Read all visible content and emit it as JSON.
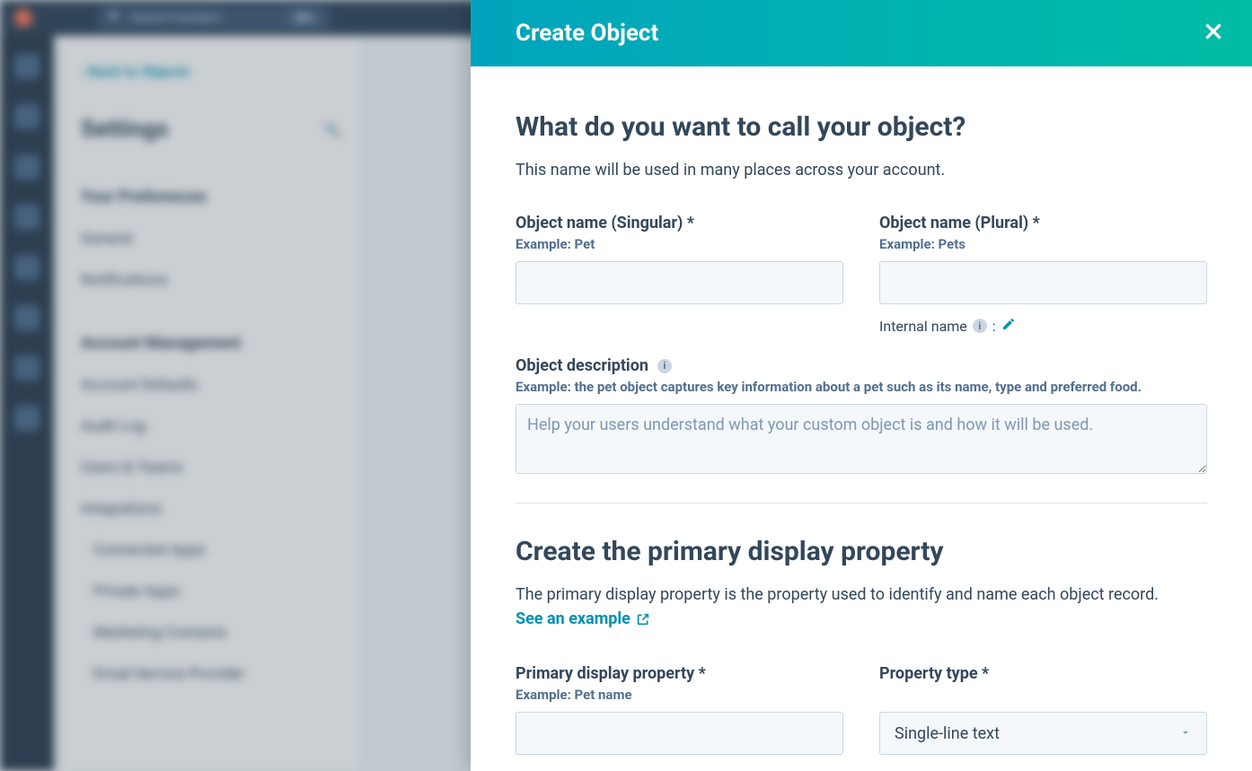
{
  "bg": {
    "search_placeholder": "Search HubSpot",
    "search_shortcut": "⌘K",
    "back_link": "‹ Back to Objects",
    "settings_title": "Settings",
    "section_prefs": "Your Preferences",
    "nav_general": "General",
    "nav_notifications": "Notifications",
    "section_account": "Account Management",
    "nav_account_defaults": "Account Defaults",
    "nav_audit_log": "Audit Log",
    "nav_users_teams": "Users & Teams",
    "nav_integrations": "Integrations",
    "nav_connected_apps": "Connected Apps",
    "nav_private_apps": "Private Apps",
    "nav_marketing_contacts": "Marketing Contacts",
    "nav_email_provider": "Email Service Provider"
  },
  "panel": {
    "title": "Create Object",
    "section1_heading": "What do you want to call your object?",
    "section1_desc": "This name will be used in many places across your account.",
    "singular_label": "Object name (Singular) *",
    "singular_example": "Example: Pet",
    "plural_label": "Object name (Plural) *",
    "plural_example": "Example: Pets",
    "internal_name_label": "Internal name",
    "internal_name_colon": ":",
    "desc_label": "Object description",
    "desc_example": "Example: the pet object captures key information about a pet such as its name, type and preferred food.",
    "desc_placeholder": "Help your users understand what your custom object is and how it will be used.",
    "section2_heading": "Create the primary display property",
    "section2_desc": "The primary display property is the property used to identify and name each object record.",
    "see_example": "See an example",
    "primary_label": "Primary display property *",
    "primary_example": "Example: Pet name",
    "property_type_label": "Property type *",
    "property_type_value": "Single-line text"
  }
}
